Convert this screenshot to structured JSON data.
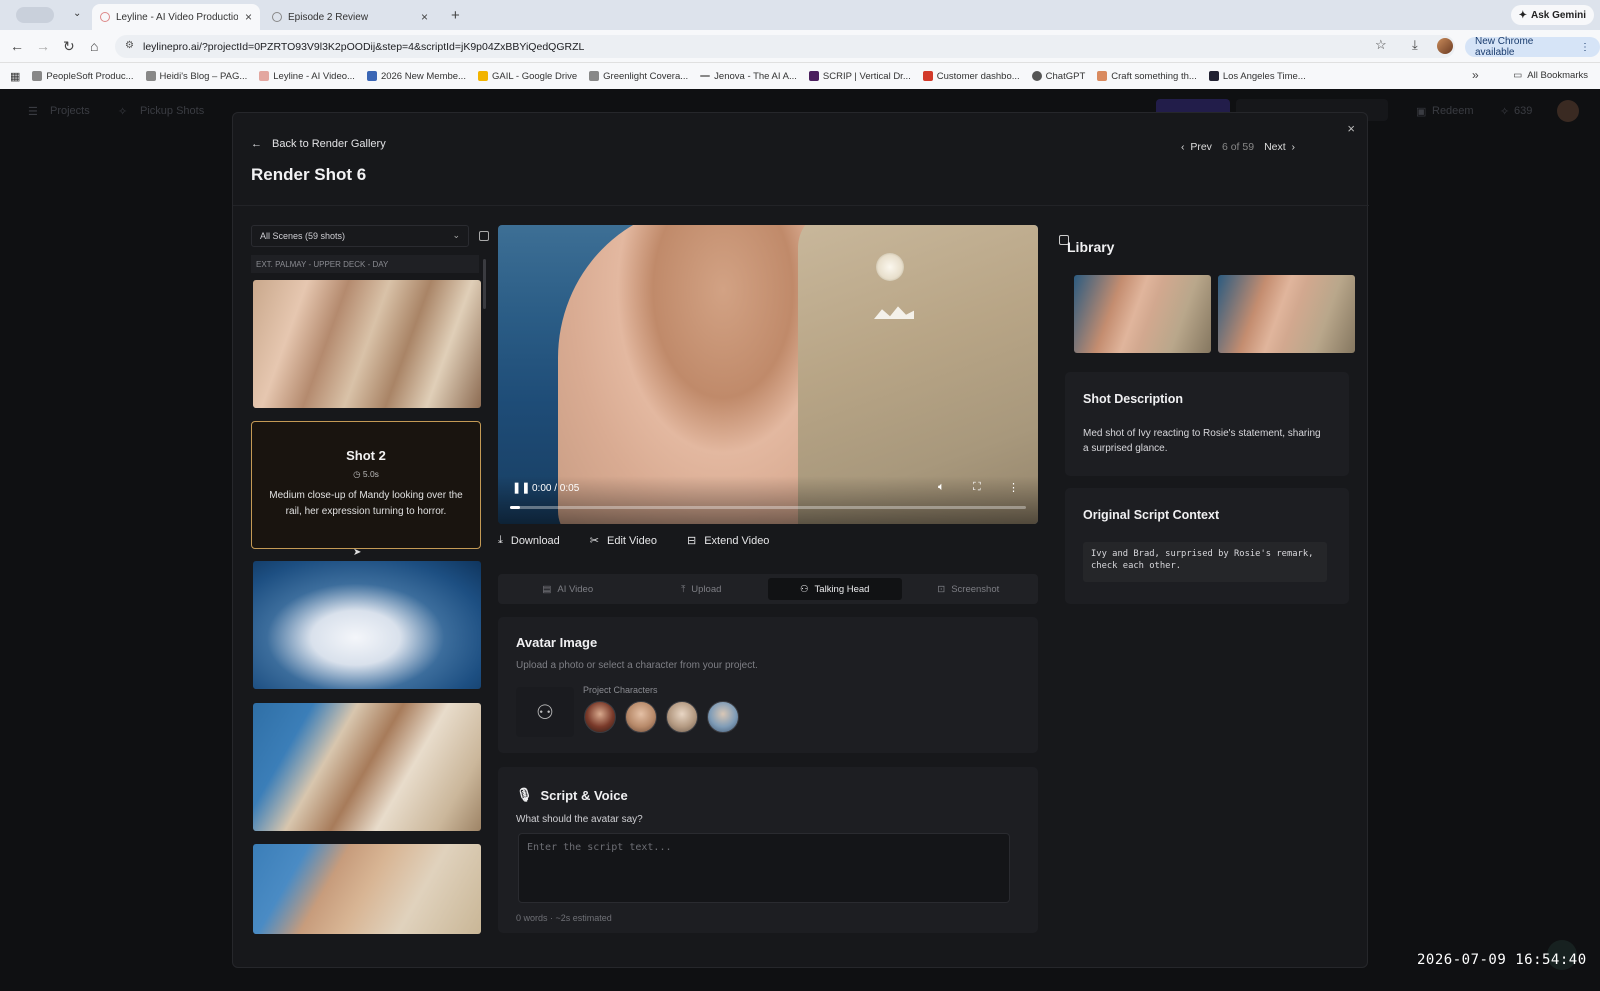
{
  "browser": {
    "tabs": [
      {
        "title": "Leyline - AI Video Production",
        "active": true
      },
      {
        "title": "Episode 2 Review",
        "active": false
      }
    ],
    "ask_gemini": "Ask Gemini",
    "url": "leylinepro.ai/?projectId=0PZRTO93V9l3K2pOODij&step=4&scriptId=jK9p04ZxBBYiQedQGRZL",
    "new_chrome": "New Chrome available",
    "bookmarks": [
      "PeopleSoft Produc...",
      "Heidi's Blog – PAG...",
      "Leyline - AI Video...",
      "2026 New Membe...",
      "GAIL - Google Drive",
      "Greenlight Covera...",
      "Jenova - The AI A...",
      "SCRIP | Vertical Dr...",
      "Customer dashbo...",
      "ChatGPT",
      "Craft something th...",
      "Los Angeles Time..."
    ],
    "all_bookmarks": "All Bookmarks"
  },
  "app_nav": {
    "projects": "Projects",
    "pickup_shots": "Pickup Shots",
    "redeem": "Redeem",
    "credits": "639"
  },
  "modal": {
    "back_label": "Back to Render Gallery",
    "title": "Render Shot 6",
    "prev": "Prev",
    "position": "6 of 59",
    "next": "Next"
  },
  "left": {
    "scene_select": "All Scenes (59 shots)",
    "scene_header": "EXT. PALMAY - UPPER DECK - DAY",
    "hover_card": {
      "title": "Shot 2",
      "duration": "5.0s",
      "description": "Medium close-up of Mandy looking over the rail, her expression turning to horror."
    }
  },
  "video": {
    "time": "0:00 / 0:05",
    "progress": 0.02
  },
  "actions": {
    "download": "Download",
    "edit": "Edit Video",
    "extend": "Extend Video"
  },
  "mode_tabs": [
    "AI Video",
    "Upload",
    "Talking Head",
    "Screenshot"
  ],
  "active_mode": "Talking Head",
  "avatar": {
    "heading": "Avatar Image",
    "subtitle": "Upload a photo or select a character from your project.",
    "characters_label": "Project Characters"
  },
  "script": {
    "heading": "Script & Voice",
    "question": "What should the avatar say?",
    "placeholder": "Enter the script text...",
    "estimate": "0 words · ~2s estimated"
  },
  "library": {
    "title": "Library"
  },
  "shot_description": {
    "heading": "Shot Description",
    "text": "Med shot of Ivy reacting to Rosie's statement, sharing a surprised glance."
  },
  "script_context": {
    "heading": "Original Script Context",
    "text": "Ivy and Brad, surprised by Rosie's remark, check each other."
  },
  "timestamp": "2026-07-09  16:54:40"
}
